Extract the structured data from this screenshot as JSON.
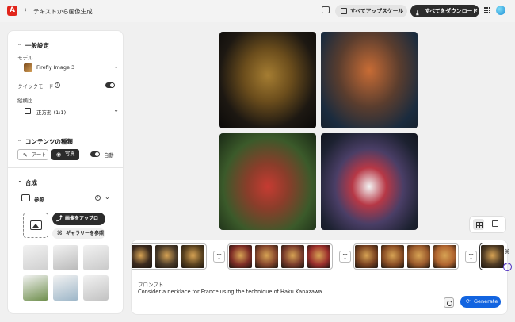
{
  "app": {
    "logo_glyph": "A",
    "back_glyph": "‹",
    "title": "テキストから画像生成"
  },
  "header": {
    "upscale_label": "すべてアップスケール",
    "download_label": "すべてをダウンロード",
    "download_glyph": "⤓"
  },
  "panel": {
    "general": {
      "heading": "一般設定",
      "chevron": "⌃"
    },
    "model": {
      "label": "モデル",
      "value": "Firefly Image 3",
      "arrow": "⌄"
    },
    "quick_mode": {
      "label": "クイックモード",
      "info": "i",
      "enabled": true
    },
    "aspect": {
      "label": "縦横比",
      "value": "正方形 (1:1)",
      "arrow": "⌄"
    },
    "content_type": {
      "heading": "コンテンツの種類",
      "chevron": "⌃",
      "art_label": "アート",
      "art_glyph": "✎",
      "photo_label": "写真",
      "photo_glyph": "◉",
      "auto_label": "自動",
      "selected": "写真"
    },
    "composite": {
      "heading": "合成",
      "chevron": "⌃",
      "reference_label": "参照",
      "info": "i",
      "arrow": "⌄",
      "upload_label": "画像をアップロー…",
      "upload_glyph": "⤴",
      "gallery_label": "ギャラリーを参照",
      "gallery_glyph": "⌘"
    },
    "reference_thumbs": [
      {
        "name": "sketch",
        "color": "#cfcfcf"
      },
      {
        "name": "paper-fold",
        "color": "#b9b9b9"
      },
      {
        "name": "room",
        "color": "#c9c9c9"
      },
      {
        "name": "road",
        "color": "#6f8f4d"
      },
      {
        "name": "sphere-figure",
        "color": "#9db6c8"
      },
      {
        "name": "owl",
        "color": "#c2c2c2"
      }
    ]
  },
  "canvas": {
    "images": [
      {
        "name": "generated-image-1"
      },
      {
        "name": "generated-image-2"
      },
      {
        "name": "generated-image-3"
      },
      {
        "name": "generated-image-4"
      }
    ]
  },
  "history": {
    "text_glyph": "T",
    "groups": [
      [
        "#3b2a1e",
        "#4d3d2a",
        "#5b4320"
      ],
      [
        "#7e2d26",
        "#86472d",
        "#7a3c2c",
        "#9b2f2c"
      ],
      [
        "#7a4321",
        "#8a4d24",
        "#9a5a2c",
        "#b0642f"
      ],
      [
        "#4f3b24",
        "#6b4428",
        "#4d5b3a",
        "#3b4b5e"
      ]
    ]
  },
  "prompt": {
    "label": "プロンプト",
    "text": "Consider a necklace for France using the technique of Haku Kanazawa.",
    "generate_label": "Generate",
    "generate_glyph": "⟳"
  }
}
